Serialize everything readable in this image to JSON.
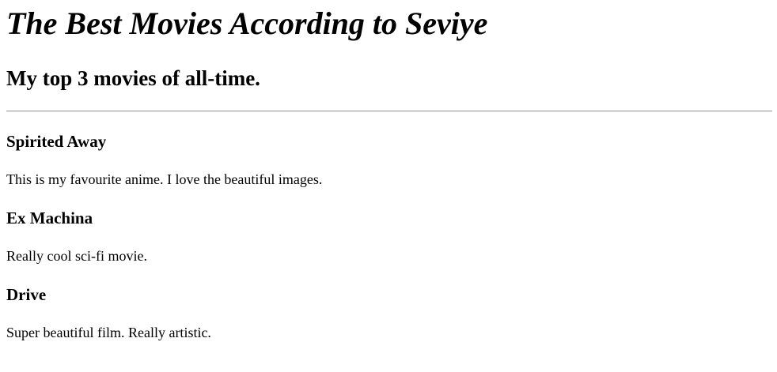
{
  "page": {
    "title": "The Best Movies According to Seviye",
    "subtitle": "My top 3 movies of all-time."
  },
  "movies": [
    {
      "title": "Spirited Away",
      "description": "This is my favourite anime. I love the beautiful images."
    },
    {
      "title": "Ex Machina",
      "description": "Really cool sci-fi movie."
    },
    {
      "title": "Drive",
      "description": "Super beautiful film. Really artistic."
    }
  ]
}
